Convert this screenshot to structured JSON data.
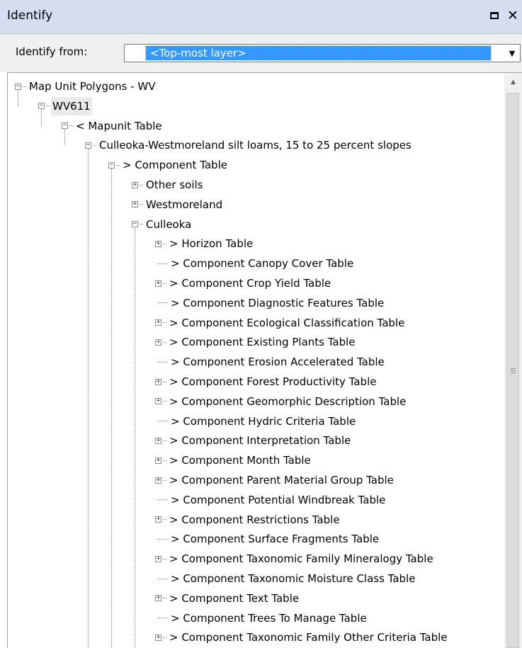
{
  "window": {
    "title": "Identify",
    "restore_icon": "restore-icon",
    "close_icon": "close-icon",
    "close_glyph": "✕"
  },
  "identify": {
    "label": "Identify from:",
    "selected": "<Top-most layer>",
    "arrow_glyph": "▼"
  },
  "tree": [
    {
      "label": "Map Unit Polygons - WV",
      "level": 0,
      "expander": "minus"
    },
    {
      "label": "WV611",
      "level": 1,
      "expander": "minus",
      "selected": true
    },
    {
      "label": "< Mapunit Table",
      "level": 2,
      "expander": "minus"
    },
    {
      "label": "Culleoka-Westmoreland silt loams, 15 to 25 percent slopes",
      "level": 3,
      "expander": "minus"
    },
    {
      "label": "> Component Table",
      "level": 4,
      "expander": "minus"
    },
    {
      "label": "Other soils",
      "level": 5,
      "expander": "plus"
    },
    {
      "label": "Westmoreland",
      "level": 5,
      "expander": "plus"
    },
    {
      "label": "Culleoka",
      "level": 5,
      "expander": "minus"
    },
    {
      "label": "> Horizon Table",
      "level": 6,
      "expander": "plus"
    },
    {
      "label": "> Component Canopy Cover Table",
      "level": 6,
      "expander": "none"
    },
    {
      "label": "> Component Crop Yield Table",
      "level": 6,
      "expander": "plus"
    },
    {
      "label": "> Component Diagnostic Features Table",
      "level": 6,
      "expander": "none"
    },
    {
      "label": "> Component Ecological Classification Table",
      "level": 6,
      "expander": "plus"
    },
    {
      "label": "> Component Existing Plants Table",
      "level": 6,
      "expander": "plus"
    },
    {
      "label": "> Component Erosion Accelerated Table",
      "level": 6,
      "expander": "none"
    },
    {
      "label": "> Component Forest Productivity Table",
      "level": 6,
      "expander": "plus"
    },
    {
      "label": "> Component Geomorphic Description Table",
      "level": 6,
      "expander": "plus"
    },
    {
      "label": "> Component Hydric Criteria Table",
      "level": 6,
      "expander": "none"
    },
    {
      "label": "> Component Interpretation Table",
      "level": 6,
      "expander": "plus"
    },
    {
      "label": "> Component Month Table",
      "level": 6,
      "expander": "plus"
    },
    {
      "label": "> Component Parent Material Group Table",
      "level": 6,
      "expander": "plus"
    },
    {
      "label": "> Component Potential Windbreak Table",
      "level": 6,
      "expander": "none"
    },
    {
      "label": "> Component Restrictions Table",
      "level": 6,
      "expander": "plus"
    },
    {
      "label": "> Component Surface Fragments Table",
      "level": 6,
      "expander": "none"
    },
    {
      "label": "> Component Taxonomic Family Mineralogy Table",
      "level": 6,
      "expander": "plus"
    },
    {
      "label": "> Component Taxonomic Moisture Class Table",
      "level": 6,
      "expander": "none"
    },
    {
      "label": "> Component Text Table",
      "level": 6,
      "expander": "plus"
    },
    {
      "label": "> Component Trees To Manage Table",
      "level": 6,
      "expander": "none"
    },
    {
      "label": "> Component Taxonomic Family Other Criteria Table",
      "level": 6,
      "expander": "plus"
    }
  ],
  "scrollbar": {
    "up_glyph": "▲"
  }
}
